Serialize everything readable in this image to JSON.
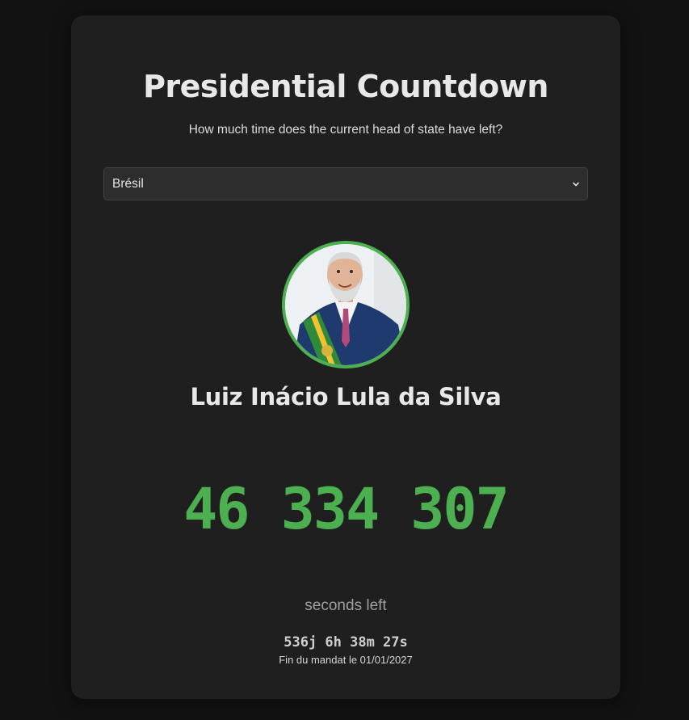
{
  "header": {
    "title": "Presidential Countdown",
    "subtitle": "How much time does the current head of state have left?"
  },
  "country_select": {
    "selected": "Brésil",
    "icon": "chevron-down-icon"
  },
  "leader": {
    "name": "Luiz Inácio Lula da Silva",
    "portrait_icon": "portrait-photo"
  },
  "countdown": {
    "seconds": "46 334 307",
    "units_label": "seconds left",
    "breakdown": "536j 6h 38m 27s",
    "end_of_term": "Fin du mandat le 01/01/2027"
  },
  "colors": {
    "background": "#121212",
    "card": "#1f1f1f",
    "accent": "#4caf50"
  }
}
